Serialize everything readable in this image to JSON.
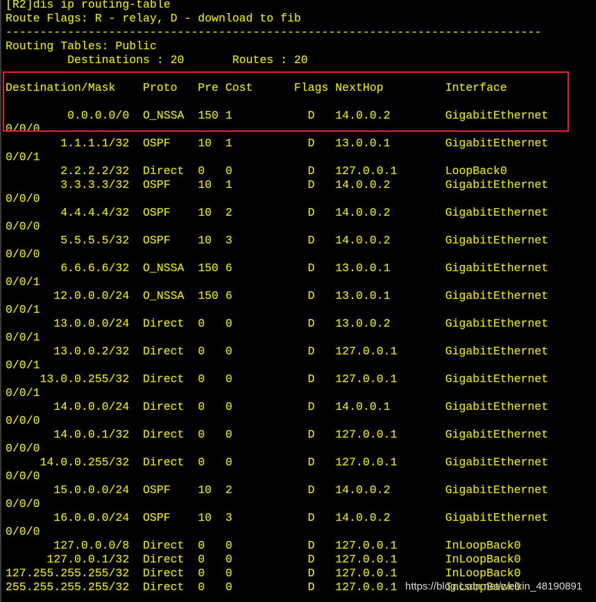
{
  "terminal": {
    "command_prompt": "[R2]dis ip routing-table",
    "route_flags": "Route Flags: R - relay, D - download to fib",
    "separator": "------------------------------------------------------------------------------",
    "routing_tables_label": "Routing Tables: Public",
    "summary": {
      "destinations_label": "Destinations",
      "destinations": "20",
      "routes_label": "Routes",
      "routes": "20"
    },
    "columns": [
      "Destination/Mask",
      "Proto",
      "Pre",
      "Cost",
      "Flags",
      "NextHop",
      "Interface"
    ],
    "routes": [
      {
        "dest": "0.0.0.0/0",
        "proto": "O_NSSA",
        "pre": "150",
        "cost": "1",
        "flags": "D",
        "nexthop": "14.0.0.2",
        "interface": "GigabitEthernet",
        "interface_cont": "0/0/0"
      },
      {
        "dest": "1.1.1.1/32",
        "proto": "OSPF",
        "pre": "10",
        "cost": "1",
        "flags": "D",
        "nexthop": "13.0.0.1",
        "interface": "GigabitEthernet",
        "interface_cont": "0/0/1"
      },
      {
        "dest": "2.2.2.2/32",
        "proto": "Direct",
        "pre": "0",
        "cost": "0",
        "flags": "D",
        "nexthop": "127.0.0.1",
        "interface": "LoopBack0",
        "interface_cont": ""
      },
      {
        "dest": "3.3.3.3/32",
        "proto": "OSPF",
        "pre": "10",
        "cost": "1",
        "flags": "D",
        "nexthop": "14.0.0.2",
        "interface": "GigabitEthernet",
        "interface_cont": "0/0/0"
      },
      {
        "dest": "4.4.4.4/32",
        "proto": "OSPF",
        "pre": "10",
        "cost": "2",
        "flags": "D",
        "nexthop": "14.0.0.2",
        "interface": "GigabitEthernet",
        "interface_cont": "0/0/0"
      },
      {
        "dest": "5.5.5.5/32",
        "proto": "OSPF",
        "pre": "10",
        "cost": "3",
        "flags": "D",
        "nexthop": "14.0.0.2",
        "interface": "GigabitEthernet",
        "interface_cont": "0/0/0"
      },
      {
        "dest": "6.6.6.6/32",
        "proto": "O_NSSA",
        "pre": "150",
        "cost": "6",
        "flags": "D",
        "nexthop": "13.0.0.1",
        "interface": "GigabitEthernet",
        "interface_cont": "0/0/1"
      },
      {
        "dest": "12.0.0.0/24",
        "proto": "O_NSSA",
        "pre": "150",
        "cost": "6",
        "flags": "D",
        "nexthop": "13.0.0.1",
        "interface": "GigabitEthernet",
        "interface_cont": "0/0/1"
      },
      {
        "dest": "13.0.0.0/24",
        "proto": "Direct",
        "pre": "0",
        "cost": "0",
        "flags": "D",
        "nexthop": "13.0.0.2",
        "interface": "GigabitEthernet",
        "interface_cont": "0/0/1"
      },
      {
        "dest": "13.0.0.2/32",
        "proto": "Direct",
        "pre": "0",
        "cost": "0",
        "flags": "D",
        "nexthop": "127.0.0.1",
        "interface": "GigabitEthernet",
        "interface_cont": "0/0/1"
      },
      {
        "dest": "13.0.0.255/32",
        "proto": "Direct",
        "pre": "0",
        "cost": "0",
        "flags": "D",
        "nexthop": "127.0.0.1",
        "interface": "GigabitEthernet",
        "interface_cont": "0/0/1"
      },
      {
        "dest": "14.0.0.0/24",
        "proto": "Direct",
        "pre": "0",
        "cost": "0",
        "flags": "D",
        "nexthop": "14.0.0.1",
        "interface": "GigabitEthernet",
        "interface_cont": "0/0/0"
      },
      {
        "dest": "14.0.0.1/32",
        "proto": "Direct",
        "pre": "0",
        "cost": "0",
        "flags": "D",
        "nexthop": "127.0.0.1",
        "interface": "GigabitEthernet",
        "interface_cont": "0/0/0"
      },
      {
        "dest": "14.0.0.255/32",
        "proto": "Direct",
        "pre": "0",
        "cost": "0",
        "flags": "D",
        "nexthop": "127.0.0.1",
        "interface": "GigabitEthernet",
        "interface_cont": "0/0/0"
      },
      {
        "dest": "15.0.0.0/24",
        "proto": "OSPF",
        "pre": "10",
        "cost": "2",
        "flags": "D",
        "nexthop": "14.0.0.2",
        "interface": "GigabitEthernet",
        "interface_cont": "0/0/0"
      },
      {
        "dest": "16.0.0.0/24",
        "proto": "OSPF",
        "pre": "10",
        "cost": "3",
        "flags": "D",
        "nexthop": "14.0.0.2",
        "interface": "GigabitEthernet",
        "interface_cont": "0/0/0"
      },
      {
        "dest": "127.0.0.0/8",
        "proto": "Direct",
        "pre": "0",
        "cost": "0",
        "flags": "D",
        "nexthop": "127.0.0.1",
        "interface": "InLoopBack0",
        "interface_cont": ""
      },
      {
        "dest": "127.0.0.1/32",
        "proto": "Direct",
        "pre": "0",
        "cost": "0",
        "flags": "D",
        "nexthop": "127.0.0.1",
        "interface": "InLoopBack0",
        "interface_cont": ""
      },
      {
        "dest": "127.255.255.255/32",
        "proto": "Direct",
        "pre": "0",
        "cost": "0",
        "flags": "D",
        "nexthop": "127.0.0.1",
        "interface": "InLoopBack0",
        "interface_cont": ""
      },
      {
        "dest": "255.255.255.255/32",
        "proto": "Direct",
        "pre": "0",
        "cost": "0",
        "flags": "D",
        "nexthop": "127.0.0.1",
        "interface": "InLoopBack0",
        "interface_cont": ""
      }
    ]
  },
  "watermark": "https://blog.csdn.net/weixin_48190891",
  "colors": {
    "text": "#e8e800",
    "background": "#000000",
    "highlight_border": "#e8202a"
  }
}
